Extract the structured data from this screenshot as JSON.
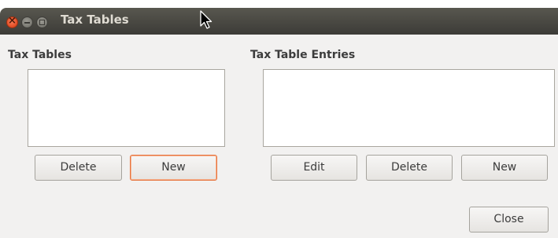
{
  "window": {
    "title": "Tax Tables"
  },
  "left_panel": {
    "title": "Tax Tables",
    "items": [],
    "buttons": {
      "delete": "Delete",
      "new": "New"
    }
  },
  "right_panel": {
    "title": "Tax Table Entries",
    "items": [],
    "buttons": {
      "edit": "Edit",
      "delete": "Delete",
      "new": "New"
    }
  },
  "footer": {
    "close": "Close"
  },
  "colors": {
    "titlebar": "#3c3b37",
    "window_bg": "#f2f1f0",
    "close_button": "#e4512a",
    "focus_border": "#e7743e"
  },
  "icons": {
    "close": "close-icon",
    "minimize": "minimize-icon",
    "maximize": "maximize-icon",
    "pointer": "mouse-pointer-icon"
  }
}
